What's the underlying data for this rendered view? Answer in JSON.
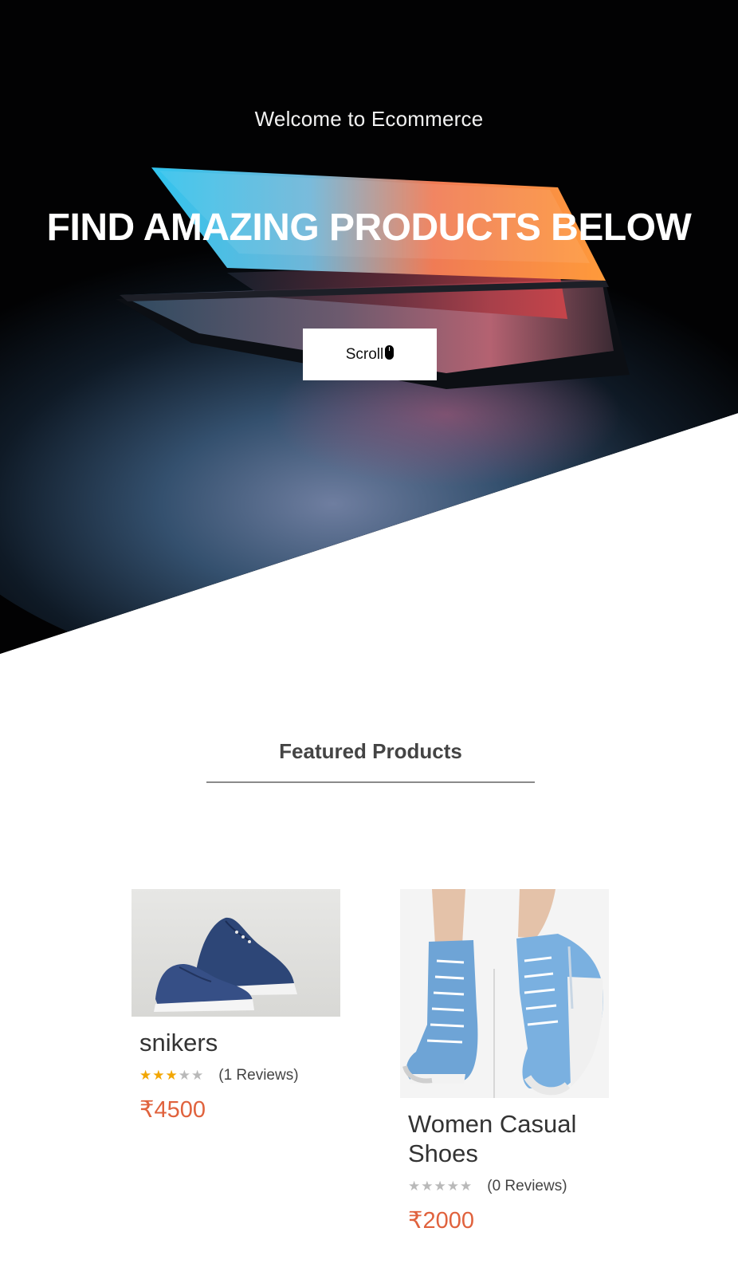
{
  "hero": {
    "welcome": "Welcome to Ecommerce",
    "title": "FIND AMAZING PRODUCTS BELOW",
    "scroll_label": "Scroll",
    "scroll_icon": "mouse-icon"
  },
  "featured": {
    "heading": "Featured Products"
  },
  "products": [
    {
      "name": "snikers",
      "rating": 3,
      "max_rating": 5,
      "reviews": "(1 Reviews)",
      "price": "₹4500"
    },
    {
      "name": "Women Casual Shoes",
      "rating": 0,
      "max_rating": 5,
      "reviews": "(0 Reviews)",
      "price": "₹2000"
    }
  ],
  "colors": {
    "price": "#e0623d",
    "star_filled": "#f2a602",
    "star_empty": "#b9b9b9"
  }
}
